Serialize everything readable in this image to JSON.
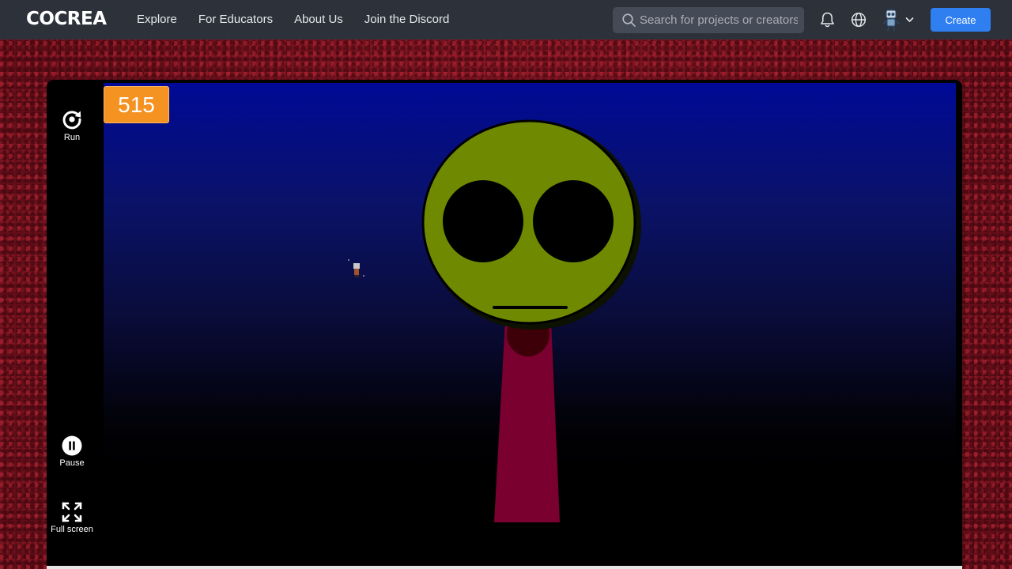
{
  "brand": "COCREA",
  "nav": {
    "links": [
      "Explore",
      "For Educators",
      "About Us",
      "Join the Discord"
    ]
  },
  "search": {
    "placeholder": "Search for projects or creators"
  },
  "icons": {
    "search": "search-icon",
    "bell": "bell-icon",
    "globe": "globe-icon",
    "avatar": "robot-avatar",
    "chevron": "chevron-down-icon"
  },
  "create_label": "Create",
  "game": {
    "score": "515",
    "controls": {
      "run_label": "Run",
      "pause_label": "Pause",
      "fullscreen_label": "Full screen"
    }
  },
  "colors": {
    "navbar": "#2c313a",
    "accent": "#2f7ff0",
    "score_badge": "#f49222",
    "face": "#6f8a00",
    "neck": "#7a0030",
    "sky_top": "#000a96"
  }
}
